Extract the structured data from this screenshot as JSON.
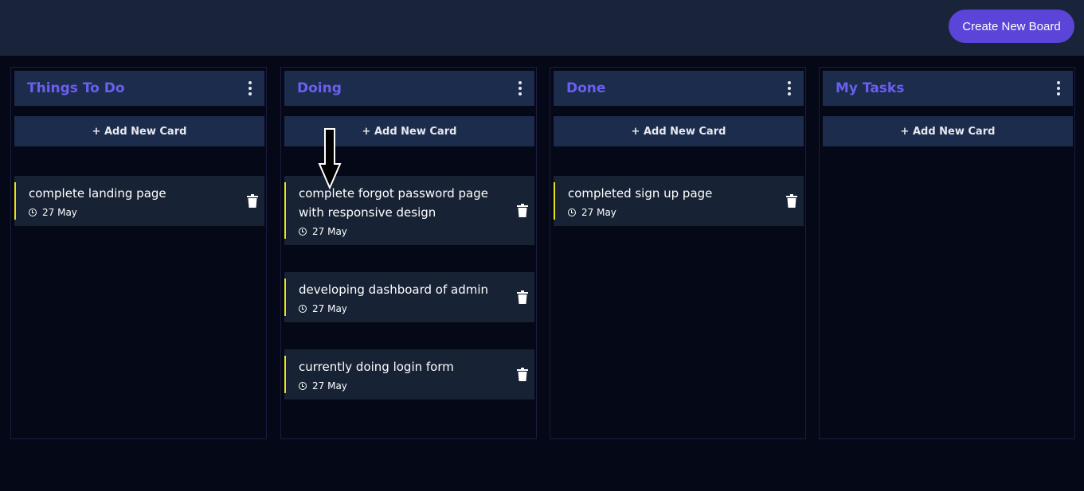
{
  "header": {
    "create_board_label": "Create New Board"
  },
  "colors": {
    "accent": "#5b44d8",
    "column_title": "#6a5ff0",
    "card_marker": "#e8e21c",
    "background": "#050816"
  },
  "boards": [
    {
      "title": "Things To Do",
      "add_card_label": "+ Add New Card",
      "cards": [
        {
          "text": "complete landing page",
          "date": "27 May"
        }
      ]
    },
    {
      "title": "Doing",
      "add_card_label": "+ Add New Card",
      "cards": [
        {
          "text": "complete forgot password page with responsive design",
          "date": "27 May"
        },
        {
          "text": "developing dashboard of admin",
          "date": "27 May"
        },
        {
          "text": "currently doing login form",
          "date": "27 May"
        }
      ]
    },
    {
      "title": "Done",
      "add_card_label": "+ Add New Card",
      "cards": [
        {
          "text": "completed sign up page",
          "date": "27 May"
        }
      ]
    },
    {
      "title": "My Tasks",
      "add_card_label": "+ Add New Card",
      "cards": []
    }
  ],
  "icons": {
    "column_menu": "kebab-menu-icon",
    "card_delete": "trash-icon",
    "card_date": "clock-icon",
    "drag_pointer": "down-arrow-icon"
  }
}
